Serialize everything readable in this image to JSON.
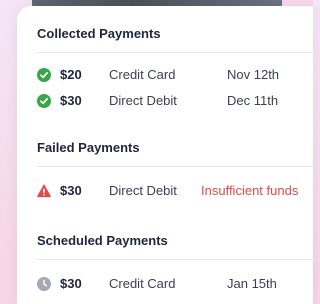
{
  "sections": {
    "collected": {
      "title": "Collected Payments",
      "rows": [
        {
          "amount": "$20",
          "method": "Credit Card",
          "status": "Nov 12th",
          "icon": "check-circle-icon"
        },
        {
          "amount": "$30",
          "method": "Direct Debit",
          "status": "Dec 11th",
          "icon": "check-circle-icon"
        }
      ]
    },
    "failed": {
      "title": "Failed Payments",
      "rows": [
        {
          "amount": "$30",
          "method": "Direct Debit",
          "status": "Insufficient funds",
          "icon": "warning-triangle-icon"
        }
      ]
    },
    "scheduled": {
      "title": "Scheduled Payments",
      "rows": [
        {
          "amount": "$30",
          "method": "Credit Card",
          "status": "Jan 15th",
          "icon": "clock-icon"
        }
      ]
    }
  },
  "colors": {
    "success": "#3aa64a",
    "error": "#e04a4a",
    "scheduled": "#a7a9b2",
    "heading": "#1f2540"
  }
}
